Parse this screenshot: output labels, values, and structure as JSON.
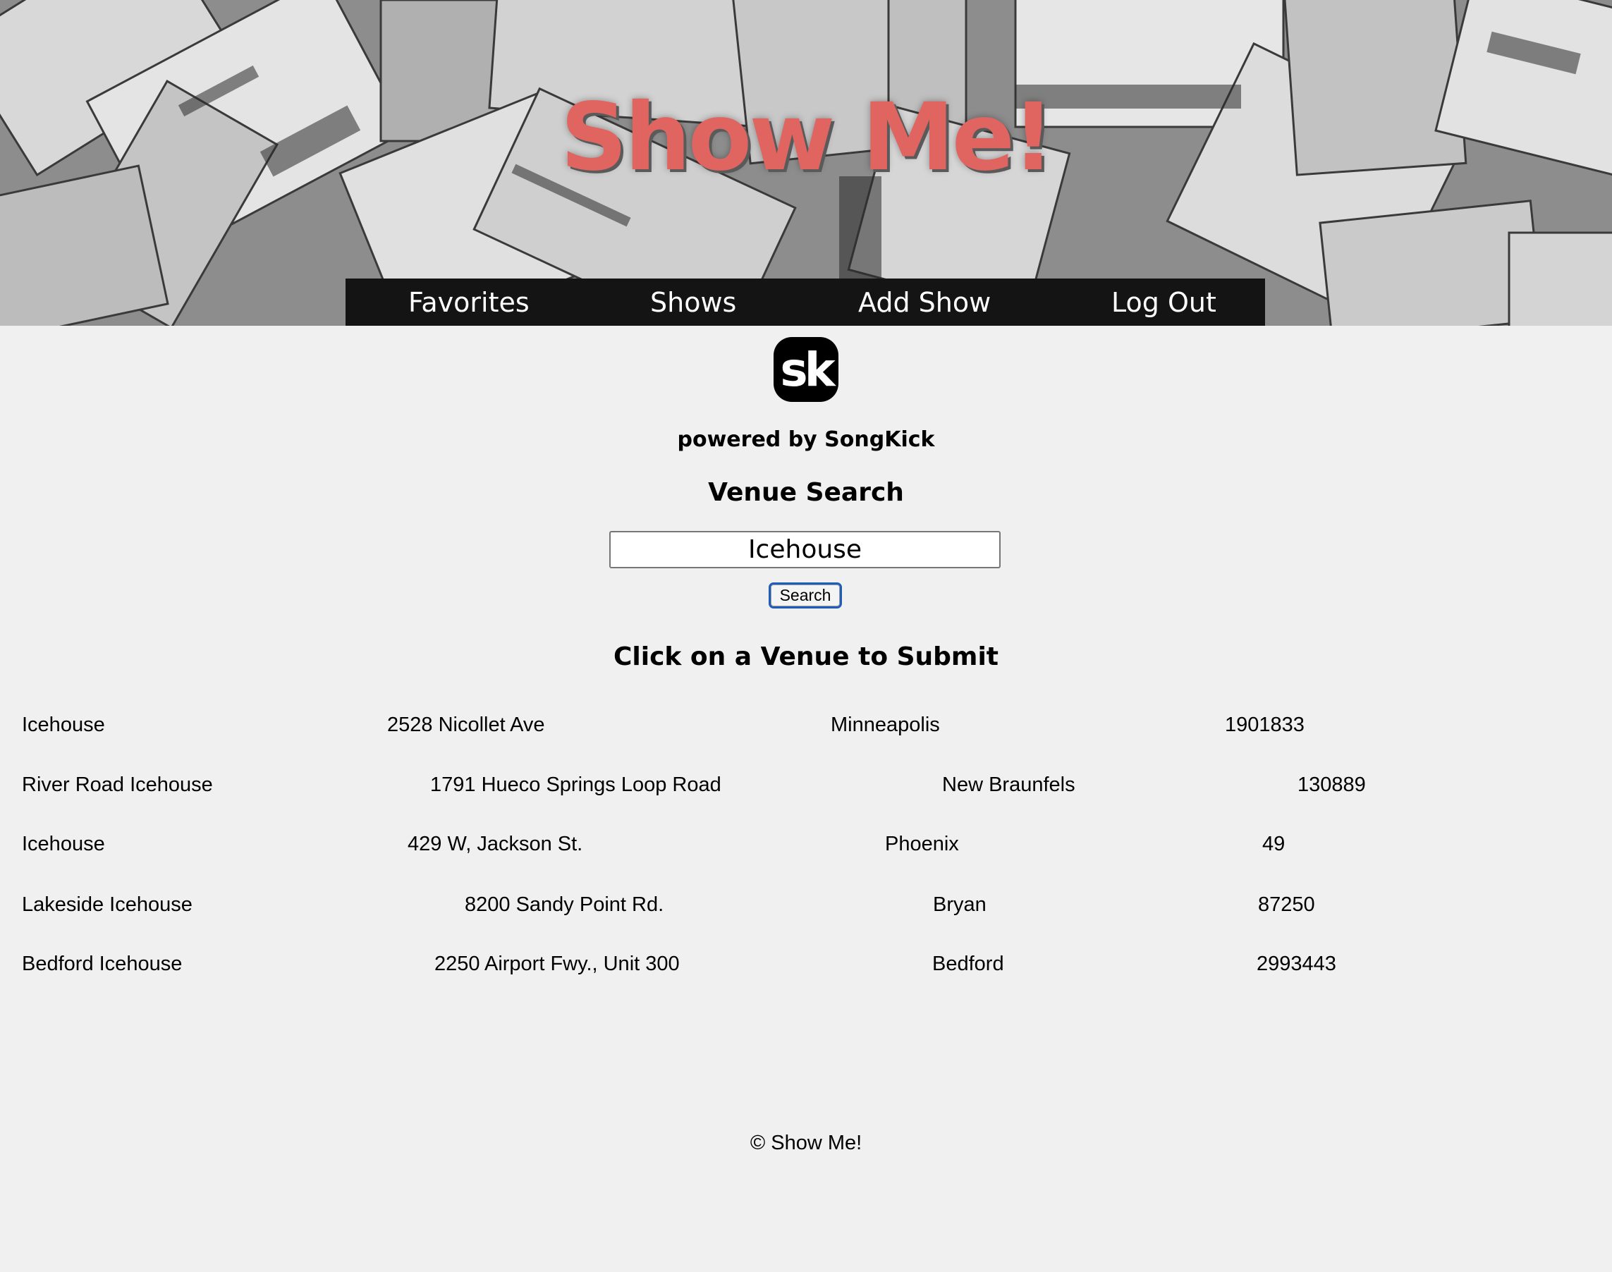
{
  "header": {
    "site_title": "Show Me!",
    "nav": [
      {
        "label": "Favorites"
      },
      {
        "label": "Shows"
      },
      {
        "label": "Add Show"
      },
      {
        "label": "Log Out"
      }
    ]
  },
  "songkick": {
    "logo_text": "sk",
    "powered_by": "powered by SongKick"
  },
  "search": {
    "heading": "Venue Search",
    "value": "Icehouse",
    "button_label": "Search"
  },
  "results": {
    "heading": "Click on a Venue to Submit",
    "venues": [
      {
        "name": "Icehouse",
        "address": "2528 Nicollet Ave",
        "city": "Minneapolis",
        "id": "1901833"
      },
      {
        "name": "River Road Icehouse",
        "address": "1791 Hueco Springs Loop Road",
        "city": "New Braunfels",
        "id": "130889"
      },
      {
        "name": "Icehouse",
        "address": "429 W, Jackson St.",
        "city": "Phoenix",
        "id": "49"
      },
      {
        "name": "Lakeside Icehouse",
        "address": "8200 Sandy Point Rd.",
        "city": "Bryan",
        "id": "87250"
      },
      {
        "name": "Bedford Icehouse",
        "address": "2250 Airport Fwy., Unit 300",
        "city": "Bedford",
        "id": "2993443"
      }
    ]
  },
  "footer": {
    "text": "© Show Me!"
  },
  "colors": {
    "title": "#e06560",
    "nav_bg": "#141414",
    "page_bg": "#f0f0f0",
    "button_focus": "#1f5dbb"
  }
}
